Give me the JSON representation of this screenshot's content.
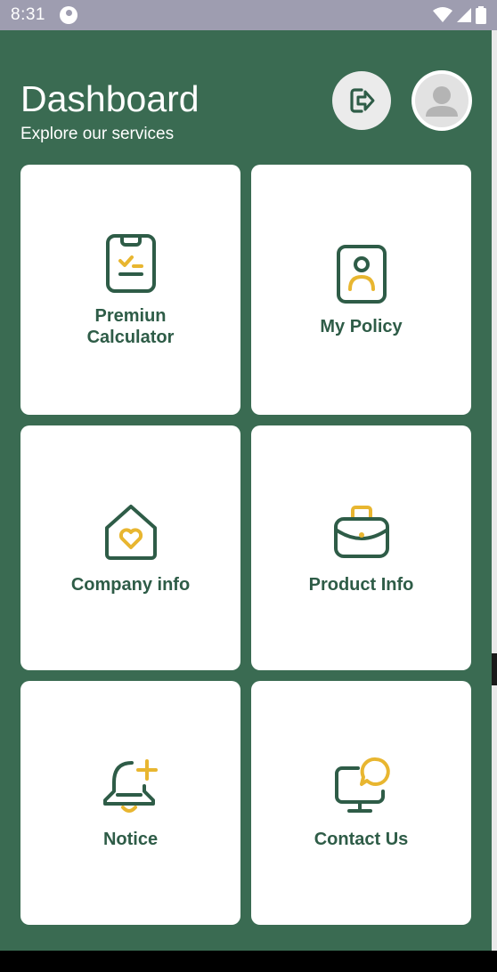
{
  "status_bar": {
    "time": "8:31",
    "icons": [
      "app-notification-icon",
      "wifi-icon",
      "signal-icon",
      "battery-icon"
    ]
  },
  "header": {
    "title": "Dashboard",
    "subtitle": "Explore our services",
    "logout_icon": "logout-icon",
    "avatar_icon": "user-icon"
  },
  "cards": [
    {
      "label": "Premiun\nCalculator",
      "icon": "calculator-clipboard-icon"
    },
    {
      "label": "My Policy",
      "icon": "id-badge-icon"
    },
    {
      "label": "Company info",
      "icon": "house-heart-icon"
    },
    {
      "label": "Product Info",
      "icon": "briefcase-icon"
    },
    {
      "label": "Notice",
      "icon": "bell-plus-icon"
    },
    {
      "label": "Contact Us",
      "icon": "monitor-chat-icon"
    }
  ],
  "colors": {
    "background": "#3a6b52",
    "icon_primary": "#2e5c47",
    "icon_accent": "#e8b630",
    "card": "#ffffff"
  }
}
